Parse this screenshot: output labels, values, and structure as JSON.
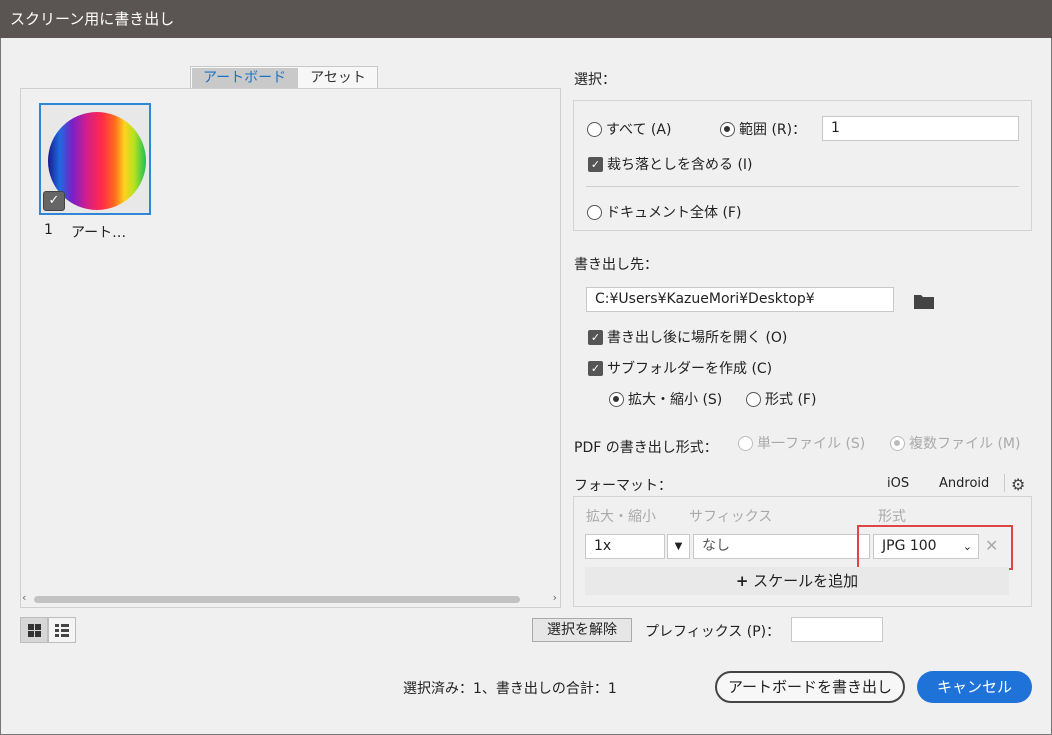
{
  "window": {
    "title": "スクリーン用に書き出し"
  },
  "tabs": [
    {
      "label": "アートボード",
      "active": true
    },
    {
      "label": "アセット",
      "active": false
    }
  ],
  "artboard": {
    "number": "1",
    "name": "アート…",
    "checked": true
  },
  "view_buttons": [
    {
      "icon": "grid-view-icon"
    },
    {
      "icon": "list-view-icon"
    }
  ],
  "selection": {
    "heading": "選択：",
    "all_label": "すべて (A)",
    "range_label": "範囲 (R)：",
    "range_value": "1",
    "bleed_label": "裁ち落としを含める (I)",
    "whole_doc_label": "ドキュメント全体 (F)"
  },
  "export_to": {
    "heading": "書き出し先：",
    "path": "C:¥Users¥KazueMori¥Desktop¥",
    "open_after_label": "書き出し後に場所を開く (O)",
    "subfolder_label": "サブフォルダーを作成 (C)",
    "scale_label": "拡大・縮小 (S)",
    "format_label": "形式 (F)"
  },
  "pdf": {
    "heading": "PDF の書き出し形式：",
    "single_label": "単一ファイル (S)",
    "multi_label": "複数ファイル (M)"
  },
  "format": {
    "heading": "フォーマット：",
    "ios_label": "iOS",
    "android_label": "Android",
    "col_scale": "拡大・縮小",
    "col_suffix": "サフィックス",
    "col_format": "形式",
    "row": {
      "scale": "1x",
      "suffix_placeholder": "なし",
      "format": "JPG 100"
    },
    "add_scale_label": "スケールを追加"
  },
  "deselect_label": "選択を解除",
  "prefix_label": "プレフィックス (P)：",
  "prefix_value": "",
  "status": "選択済み：1、書き出しの合計：1",
  "export_button": "アートボードを書き出し",
  "cancel_button": "キャンセル",
  "colors": {
    "accent": "#1f73d8",
    "highlight": "#e04545"
  }
}
